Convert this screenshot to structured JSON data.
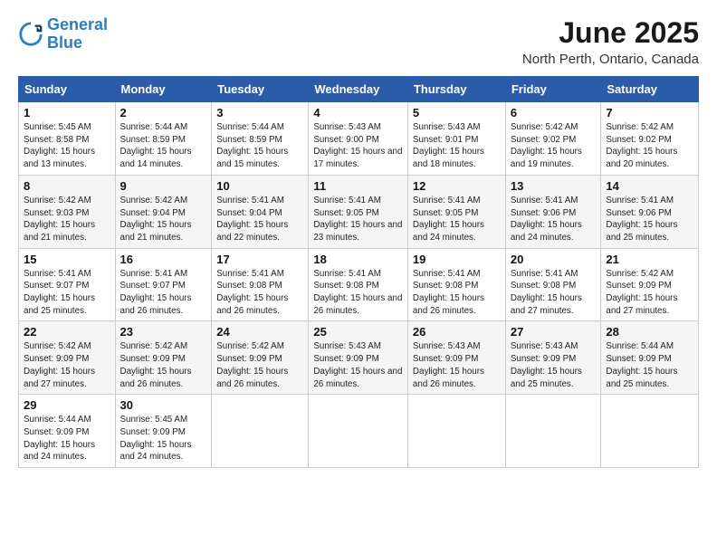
{
  "logo": {
    "line1": "General",
    "line2": "Blue"
  },
  "title": "June 2025",
  "location": "North Perth, Ontario, Canada",
  "weekdays": [
    "Sunday",
    "Monday",
    "Tuesday",
    "Wednesday",
    "Thursday",
    "Friday",
    "Saturday"
  ],
  "weeks": [
    [
      {
        "day": "1",
        "sunrise": "Sunrise: 5:45 AM",
        "sunset": "Sunset: 8:58 PM",
        "daylight": "Daylight: 15 hours and 13 minutes."
      },
      {
        "day": "2",
        "sunrise": "Sunrise: 5:44 AM",
        "sunset": "Sunset: 8:59 PM",
        "daylight": "Daylight: 15 hours and 14 minutes."
      },
      {
        "day": "3",
        "sunrise": "Sunrise: 5:44 AM",
        "sunset": "Sunset: 8:59 PM",
        "daylight": "Daylight: 15 hours and 15 minutes."
      },
      {
        "day": "4",
        "sunrise": "Sunrise: 5:43 AM",
        "sunset": "Sunset: 9:00 PM",
        "daylight": "Daylight: 15 hours and 17 minutes."
      },
      {
        "day": "5",
        "sunrise": "Sunrise: 5:43 AM",
        "sunset": "Sunset: 9:01 PM",
        "daylight": "Daylight: 15 hours and 18 minutes."
      },
      {
        "day": "6",
        "sunrise": "Sunrise: 5:42 AM",
        "sunset": "Sunset: 9:02 PM",
        "daylight": "Daylight: 15 hours and 19 minutes."
      },
      {
        "day": "7",
        "sunrise": "Sunrise: 5:42 AM",
        "sunset": "Sunset: 9:02 PM",
        "daylight": "Daylight: 15 hours and 20 minutes."
      }
    ],
    [
      {
        "day": "8",
        "sunrise": "Sunrise: 5:42 AM",
        "sunset": "Sunset: 9:03 PM",
        "daylight": "Daylight: 15 hours and 21 minutes."
      },
      {
        "day": "9",
        "sunrise": "Sunrise: 5:42 AM",
        "sunset": "Sunset: 9:04 PM",
        "daylight": "Daylight: 15 hours and 21 minutes."
      },
      {
        "day": "10",
        "sunrise": "Sunrise: 5:41 AM",
        "sunset": "Sunset: 9:04 PM",
        "daylight": "Daylight: 15 hours and 22 minutes."
      },
      {
        "day": "11",
        "sunrise": "Sunrise: 5:41 AM",
        "sunset": "Sunset: 9:05 PM",
        "daylight": "Daylight: 15 hours and 23 minutes."
      },
      {
        "day": "12",
        "sunrise": "Sunrise: 5:41 AM",
        "sunset": "Sunset: 9:05 PM",
        "daylight": "Daylight: 15 hours and 24 minutes."
      },
      {
        "day": "13",
        "sunrise": "Sunrise: 5:41 AM",
        "sunset": "Sunset: 9:06 PM",
        "daylight": "Daylight: 15 hours and 24 minutes."
      },
      {
        "day": "14",
        "sunrise": "Sunrise: 5:41 AM",
        "sunset": "Sunset: 9:06 PM",
        "daylight": "Daylight: 15 hours and 25 minutes."
      }
    ],
    [
      {
        "day": "15",
        "sunrise": "Sunrise: 5:41 AM",
        "sunset": "Sunset: 9:07 PM",
        "daylight": "Daylight: 15 hours and 25 minutes."
      },
      {
        "day": "16",
        "sunrise": "Sunrise: 5:41 AM",
        "sunset": "Sunset: 9:07 PM",
        "daylight": "Daylight: 15 hours and 26 minutes."
      },
      {
        "day": "17",
        "sunrise": "Sunrise: 5:41 AM",
        "sunset": "Sunset: 9:08 PM",
        "daylight": "Daylight: 15 hours and 26 minutes."
      },
      {
        "day": "18",
        "sunrise": "Sunrise: 5:41 AM",
        "sunset": "Sunset: 9:08 PM",
        "daylight": "Daylight: 15 hours and 26 minutes."
      },
      {
        "day": "19",
        "sunrise": "Sunrise: 5:41 AM",
        "sunset": "Sunset: 9:08 PM",
        "daylight": "Daylight: 15 hours and 26 minutes."
      },
      {
        "day": "20",
        "sunrise": "Sunrise: 5:41 AM",
        "sunset": "Sunset: 9:08 PM",
        "daylight": "Daylight: 15 hours and 27 minutes."
      },
      {
        "day": "21",
        "sunrise": "Sunrise: 5:42 AM",
        "sunset": "Sunset: 9:09 PM",
        "daylight": "Daylight: 15 hours and 27 minutes."
      }
    ],
    [
      {
        "day": "22",
        "sunrise": "Sunrise: 5:42 AM",
        "sunset": "Sunset: 9:09 PM",
        "daylight": "Daylight: 15 hours and 27 minutes."
      },
      {
        "day": "23",
        "sunrise": "Sunrise: 5:42 AM",
        "sunset": "Sunset: 9:09 PM",
        "daylight": "Daylight: 15 hours and 26 minutes."
      },
      {
        "day": "24",
        "sunrise": "Sunrise: 5:42 AM",
        "sunset": "Sunset: 9:09 PM",
        "daylight": "Daylight: 15 hours and 26 minutes."
      },
      {
        "day": "25",
        "sunrise": "Sunrise: 5:43 AM",
        "sunset": "Sunset: 9:09 PM",
        "daylight": "Daylight: 15 hours and 26 minutes."
      },
      {
        "day": "26",
        "sunrise": "Sunrise: 5:43 AM",
        "sunset": "Sunset: 9:09 PM",
        "daylight": "Daylight: 15 hours and 26 minutes."
      },
      {
        "day": "27",
        "sunrise": "Sunrise: 5:43 AM",
        "sunset": "Sunset: 9:09 PM",
        "daylight": "Daylight: 15 hours and 25 minutes."
      },
      {
        "day": "28",
        "sunrise": "Sunrise: 5:44 AM",
        "sunset": "Sunset: 9:09 PM",
        "daylight": "Daylight: 15 hours and 25 minutes."
      }
    ],
    [
      {
        "day": "29",
        "sunrise": "Sunrise: 5:44 AM",
        "sunset": "Sunset: 9:09 PM",
        "daylight": "Daylight: 15 hours and 24 minutes."
      },
      {
        "day": "30",
        "sunrise": "Sunrise: 5:45 AM",
        "sunset": "Sunset: 9:09 PM",
        "daylight": "Daylight: 15 hours and 24 minutes."
      },
      null,
      null,
      null,
      null,
      null
    ]
  ]
}
